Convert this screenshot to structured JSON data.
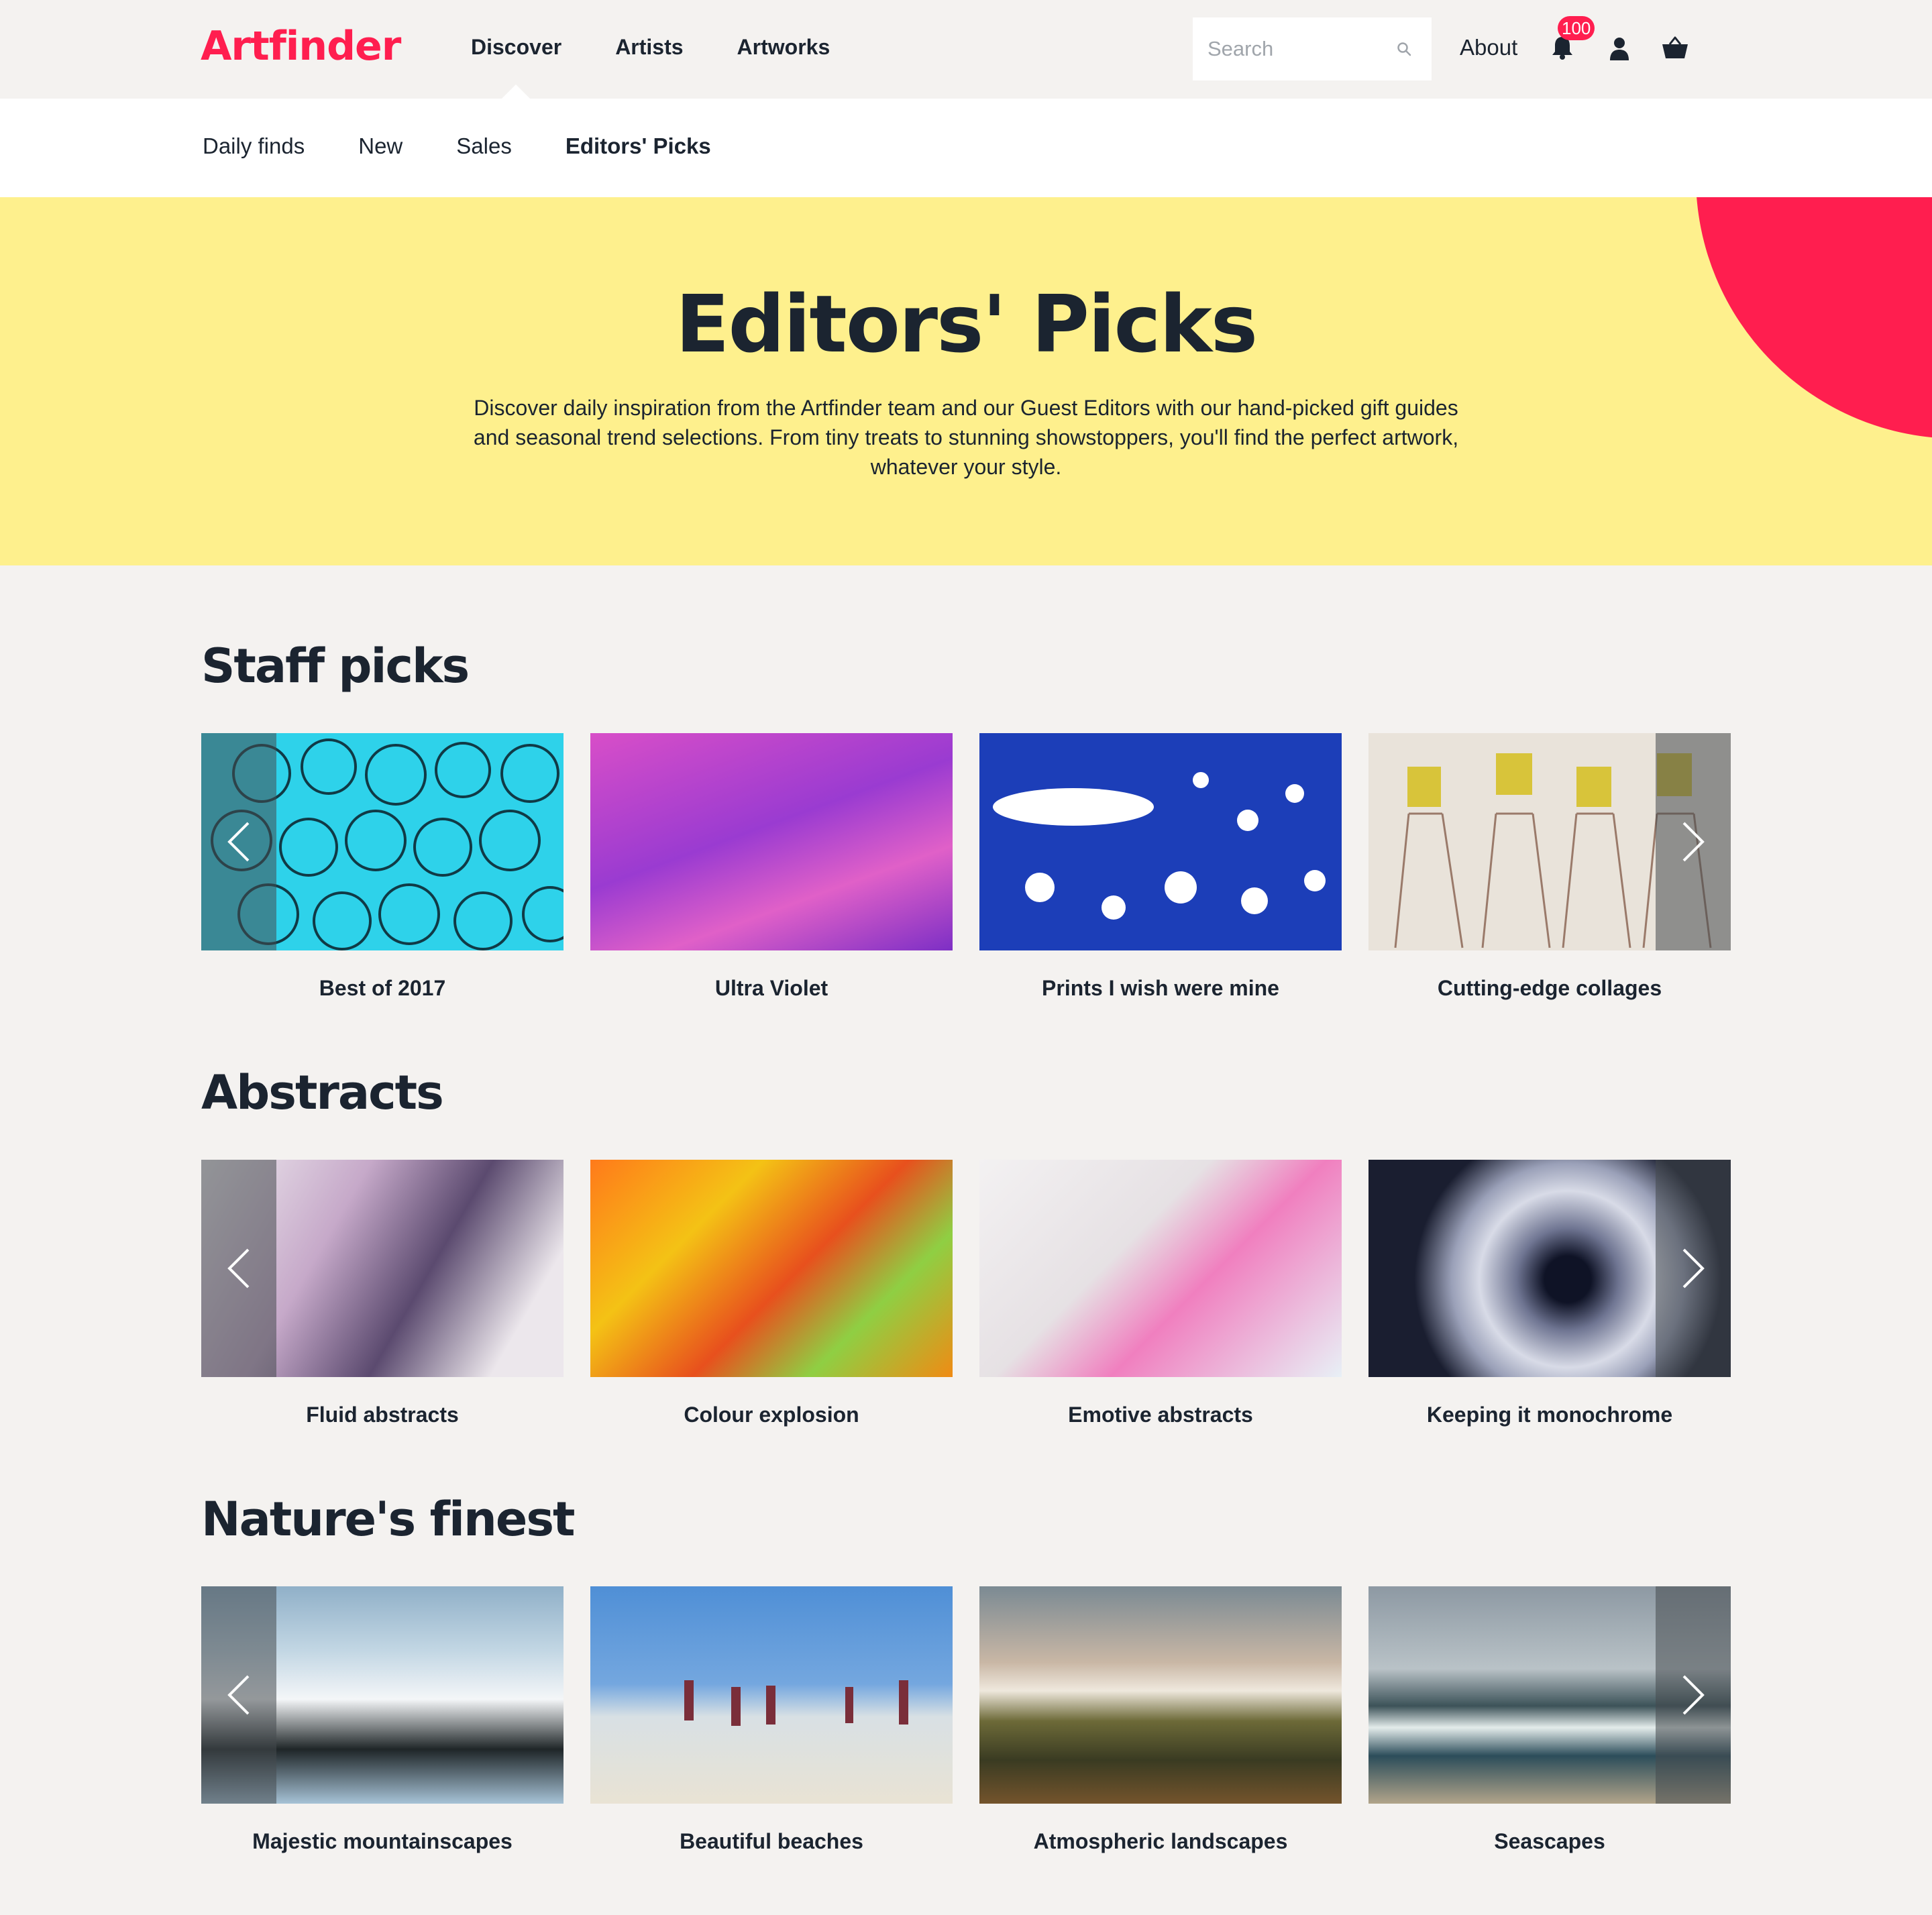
{
  "header": {
    "logo": "Artfinder",
    "nav": [
      "Discover",
      "Artists",
      "Artworks"
    ],
    "search_placeholder": "Search",
    "about": "About",
    "notifications_count": "100"
  },
  "subnav": {
    "items": [
      "Daily finds",
      "New",
      "Sales",
      "Editors' Picks"
    ],
    "active": "Editors' Picks"
  },
  "hero": {
    "title": "Editors' Picks",
    "description": "Discover daily inspiration from the Artfinder team and our Guest Editors with our hand-picked gift guides and seasonal trend selections. From tiny treats to stunning showstoppers, you'll find the perfect artwork, whatever your style.",
    "background_color": "#fef08d",
    "accent_color": "#ff1e4f"
  },
  "sections": [
    {
      "title": "Staff picks",
      "cards": [
        "Best of 2017",
        "Ultra Violet",
        "Prints I wish were mine",
        "Cutting-edge collages"
      ]
    },
    {
      "title": "Abstracts",
      "cards": [
        "Fluid abstracts",
        "Colour explosion",
        "Emotive abstracts",
        "Keeping it monochrome"
      ]
    },
    {
      "title": "Nature's finest",
      "cards": [
        "Majestic mountainscapes",
        "Beautiful beaches",
        "Atmospheric landscapes",
        "Seascapes"
      ]
    }
  ],
  "icons": {
    "search": "search-icon",
    "bell": "bell-icon",
    "user": "user-icon",
    "basket": "basket-icon",
    "prev": "chevron-left-icon",
    "next": "chevron-right-icon"
  }
}
